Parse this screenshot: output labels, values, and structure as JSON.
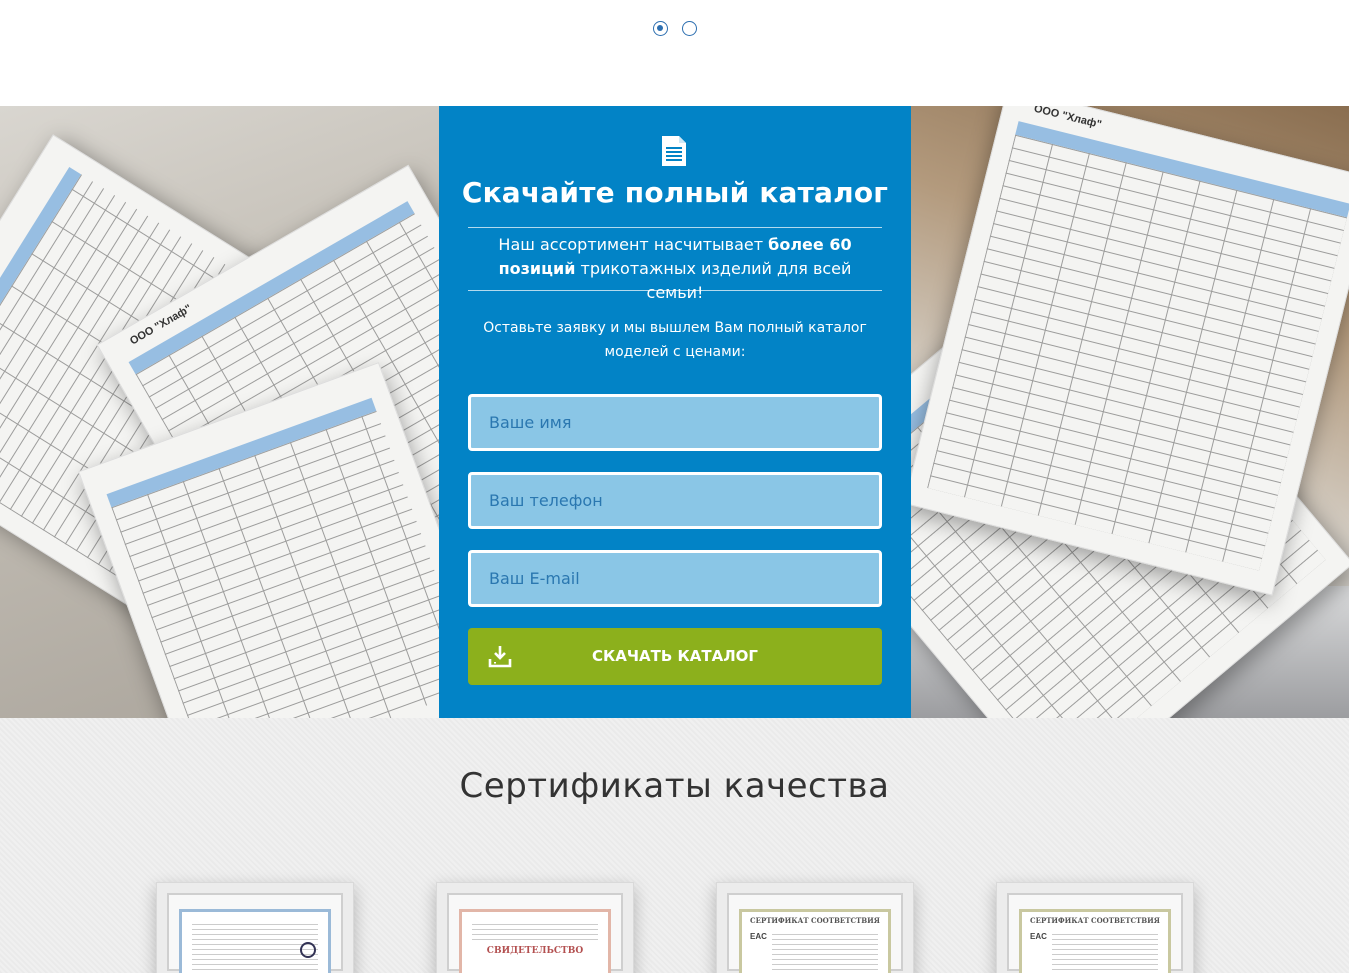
{
  "slider": {
    "dots": [
      {
        "active": true
      },
      {
        "active": false
      }
    ]
  },
  "hero": {
    "sheet_company": "ООО \"Хлаф\""
  },
  "catalog_form": {
    "icon": "document-icon",
    "title": "Скачайте полный каталог",
    "assortment_prefix": "Наш ассортимент насчитывает ",
    "assortment_bold": "более 60 позиций",
    "assortment_suffix": " трикотажных изделий для всей семьи!",
    "note": "Оставьте заявку и мы вышлем Вам полный каталог моделей с ценами:",
    "name_placeholder": "Ваше имя",
    "phone_placeholder": "Ваш телефон",
    "email_placeholder": "Ваш E-mail",
    "submit_label": "Скачать каталог",
    "submit_icon": "download-icon",
    "colors": {
      "panel": "#0283c6",
      "button": "#8cb01c",
      "field": "#8ac6e6"
    }
  },
  "certificates": {
    "title": "Сертификаты качества",
    "items": [
      {
        "caption": ""
      },
      {
        "caption": "СВИДЕТЕЛЬСТВО"
      },
      {
        "caption": "СЕРТИФИКАТ СООТВЕТСТВИЯ"
      },
      {
        "caption": "СЕРТИФИКАТ СООТВЕТСТВИЯ"
      }
    ]
  }
}
